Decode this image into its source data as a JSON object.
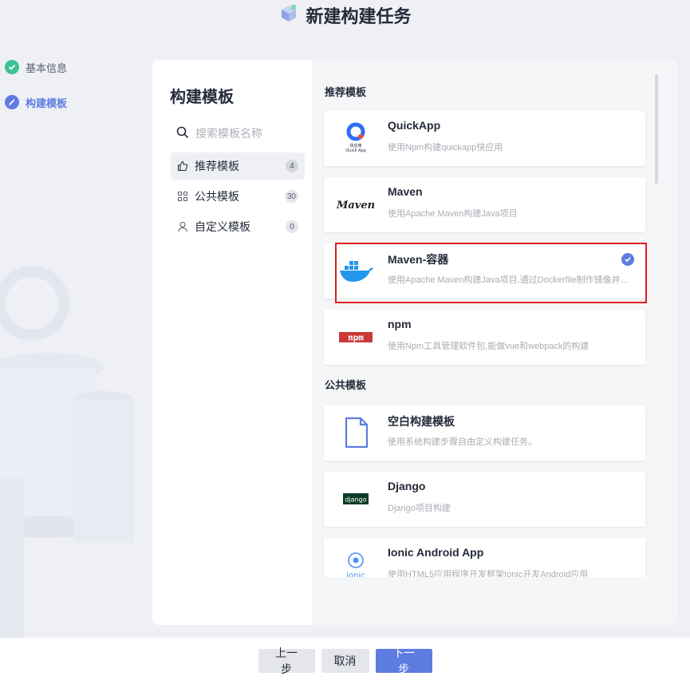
{
  "page": {
    "title": "新建构建任务"
  },
  "steps": [
    {
      "label": "基本信息",
      "state": "done"
    },
    {
      "label": "构建模板",
      "state": "active"
    }
  ],
  "panel": {
    "title": "构建模板",
    "search_placeholder": "搜索模板名称",
    "categories": [
      {
        "label": "推荐模板",
        "count": "4",
        "icon": "thumbs-up-icon",
        "active": true
      },
      {
        "label": "公共模板",
        "count": "30",
        "icon": "grid-icon",
        "active": false
      },
      {
        "label": "自定义模板",
        "count": "0",
        "icon": "user-icon",
        "active": false
      }
    ]
  },
  "groups": {
    "recommended": {
      "title": "推荐模板",
      "items": [
        {
          "name": "QuickApp",
          "desc": "使用Npm构建quickapp快应用",
          "logo_text": "快应用",
          "logo_sub": "Quick App"
        },
        {
          "name": "Maven",
          "desc": "使用Apache Maven构建Java项目",
          "logo_text": "Maven"
        },
        {
          "name": "Maven-容器",
          "desc": "使用Apache Maven构建Java项目,通过Dockerfile制作镜像并...",
          "selected": true
        },
        {
          "name": "npm",
          "desc": "使用Npm工具管理软件包,能做vue和webpack的构建",
          "logo_text": "npm"
        }
      ]
    },
    "public": {
      "title": "公共模板",
      "items": [
        {
          "name": "空白构建模板",
          "desc": "使用系统构建步骤自由定义构建任务。"
        },
        {
          "name": "Django",
          "desc": "Django项目构建",
          "logo_text": "django"
        },
        {
          "name": "Ionic Android App",
          "desc": "使用HTML5应用程序开发框架Ionic开发Android应用",
          "logo_text": "ionic"
        }
      ]
    }
  },
  "footer": {
    "prev": "上一步",
    "cancel": "取消",
    "next": "下一步"
  },
  "colors": {
    "primary": "#5e7ce0",
    "success": "#3ac295",
    "highlight": "#e11d1d"
  }
}
